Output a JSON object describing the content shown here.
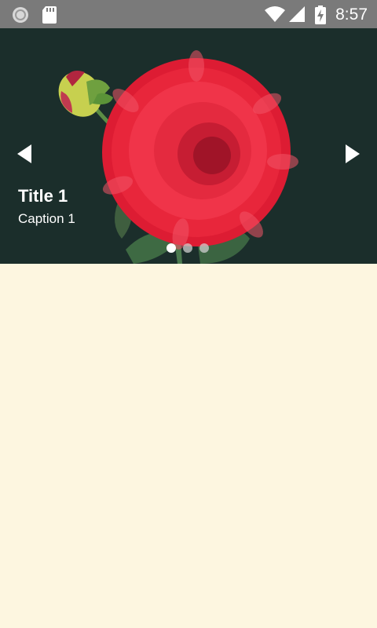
{
  "status_bar": {
    "time": "8:57",
    "icons": [
      "sync-icon",
      "sd-card-icon",
      "wifi-icon",
      "signal-icon",
      "battery-charging-icon"
    ]
  },
  "carousel": {
    "slides": [
      {
        "title": "Title 1",
        "caption": "Caption 1"
      }
    ],
    "active_index": 0,
    "indicator_count": 3,
    "prev_icon": "chevron-left-icon",
    "next_icon": "chevron-right-icon"
  },
  "colors": {
    "status_bar": "#7a7a7a",
    "carousel_background": "#1b2e2b",
    "page_background": "#fdf6e0"
  }
}
